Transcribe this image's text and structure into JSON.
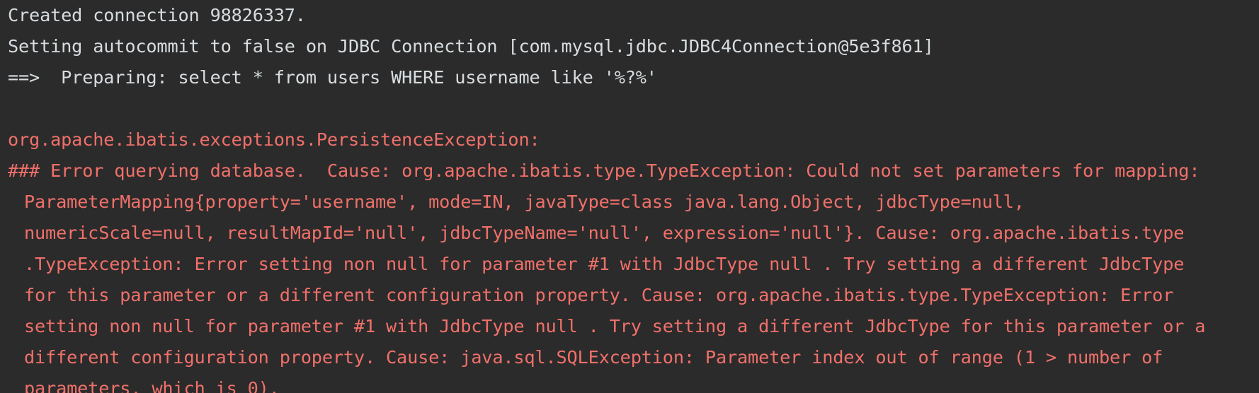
{
  "colors": {
    "background": "#2b2b2b",
    "info_text": "#d7dce0",
    "error_text": "#f0706a"
  },
  "log": {
    "info_lines": [
      "Created connection 98826337.",
      "Setting autocommit to false on JDBC Connection [com.mysql.jdbc.JDBC4Connection@5e3f861]",
      "==>  Preparing: select * from users WHERE username like '%?%'"
    ],
    "exception_header": "org.apache.ibatis.exceptions.PersistenceException:",
    "error_first_line": "### Error querying database.  Cause: org.apache.ibatis.type.TypeException: Could not set parameters for mapping:",
    "error_continuation": [
      "ParameterMapping{property='username', mode=IN, javaType=class java.lang.Object, jdbcType=null,",
      "numericScale=null, resultMapId='null', jdbcTypeName='null', expression='null'}. Cause: org.apache.ibatis.type",
      ".TypeException: Error setting non null for parameter #1 with JdbcType null . Try setting a different JdbcType",
      "for this parameter or a different configuration property. Cause: org.apache.ibatis.type.TypeException: Error",
      "setting non null for parameter #1 with JdbcType null . Try setting a different JdbcType for this parameter or a",
      "different configuration property. Cause: java.sql.SQLException: Parameter index out of range (1 > number of",
      "parameters, which is 0)."
    ]
  }
}
